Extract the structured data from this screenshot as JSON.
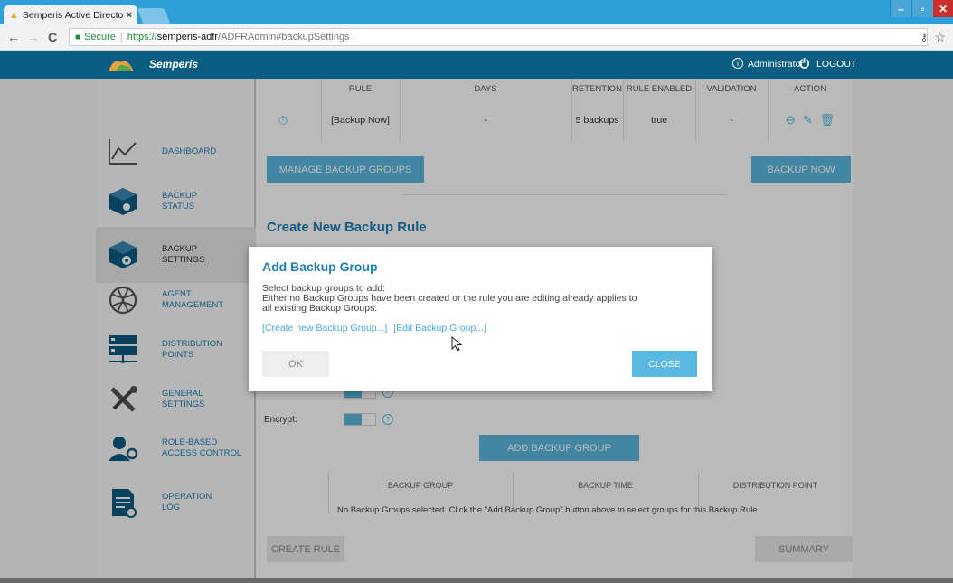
{
  "browser": {
    "tab_title": "Semperis Active Directo",
    "tab_close": "×",
    "secure_label": "Secure",
    "url_proto": "https://",
    "url_host": "semperis-adfr",
    "url_path": "/ADFRAdmin#backupSettings"
  },
  "header": {
    "brand": "Semperis",
    "user": "Administrator",
    "logout": "LOGOUT"
  },
  "sidebar": {
    "items": [
      {
        "label_line1": "DASHBOARD",
        "label_line2": "",
        "icon": "dashboard-chart-icon",
        "active": false
      },
      {
        "label_line1": "BACKUP",
        "label_line2": "STATUS",
        "icon": "backup-status-icon",
        "active": false
      },
      {
        "label_line1": "BACKUP",
        "label_line2": "SETTINGS",
        "icon": "backup-settings-icon",
        "active": true
      },
      {
        "label_line1": "AGENT",
        "label_line2": "MANAGEMENT",
        "icon": "agent-management-icon",
        "active": false
      },
      {
        "label_line1": "DISTRIBUTION",
        "label_line2": "POINTS",
        "icon": "distribution-points-icon",
        "active": false
      },
      {
        "label_line1": "GENERAL",
        "label_line2": "SETTINGS",
        "icon": "tools-icon",
        "active": false
      },
      {
        "label_line1": "ROLE-BASED",
        "label_line2": "ACCESS CONTROL",
        "icon": "role-access-icon",
        "active": false
      },
      {
        "label_line1": "OPERATION",
        "label_line2": "LOG",
        "icon": "operation-log-icon",
        "active": false
      }
    ]
  },
  "rules_table": {
    "columns": [
      "RULE",
      "DAYS",
      "RETENTION",
      "RULE ENABLED",
      "VALIDATION",
      "ACTION"
    ],
    "row": {
      "rule": "[Backup Now]",
      "days": "-",
      "retention": "5 backups",
      "enabled": "true",
      "validation": "-"
    }
  },
  "buttons": {
    "manage_groups": "MANAGE BACKUP GROUPS",
    "backup_now": "BACKUP NOW",
    "add_backup_group": "ADD BACKUP GROUP",
    "create_rule": "CREATE RULE",
    "summary": "SUMMARY"
  },
  "form": {
    "section_title": "Create New Backup Rule",
    "encrypt_label": "Encrypt:"
  },
  "groups_table": {
    "columns": [
      "BACKUP GROUP",
      "BACKUP TIME",
      "DISTRIBUTION POINT"
    ],
    "empty_message": "No Backup Groups selected. Click the \"Add Backup Group\" button above to select groups for this Backup Rule."
  },
  "modal": {
    "title": "Add Backup Group",
    "line1": "Select backup groups to add:",
    "line2": "Either no Backup Groups have been created or the rule you are editing already applies to",
    "line3": "all existing Backup Groups.",
    "link_create": "[Create new Backup Group...]",
    "link_edit": "[Edit Backup Group...]",
    "ok": "OK",
    "close": "CLOSE"
  },
  "colors": {
    "header_bg": "#0a5d82",
    "accent": "#5bb8e0",
    "link": "#4aa8d9",
    "title": "#1f7fb1"
  }
}
